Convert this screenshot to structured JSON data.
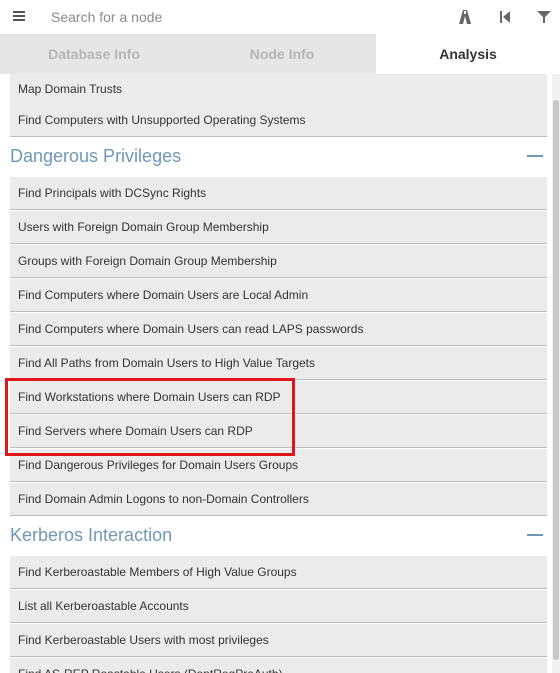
{
  "search": {
    "placeholder": "Search for a node"
  },
  "tabs": [
    {
      "label": "Database Info"
    },
    {
      "label": "Node Info"
    },
    {
      "label": "Analysis"
    }
  ],
  "queries_top": [
    "Map Domain Trusts",
    "Find Computers with Unsupported Operating Systems"
  ],
  "sections": [
    {
      "title": "Dangerous Privileges",
      "queries": [
        "Find Principals with DCSync Rights",
        "Users with Foreign Domain Group Membership",
        "Groups with Foreign Domain Group Membership",
        "Find Computers where Domain Users are Local Admin",
        "Find Computers where Domain Users can read LAPS passwords",
        "Find All Paths from Domain Users to High Value Targets",
        "Find Workstations where Domain Users can RDP",
        "Find Servers where Domain Users can RDP",
        "Find Dangerous Privileges for Domain Users Groups",
        "Find Domain Admin Logons to non-Domain Controllers"
      ]
    },
    {
      "title": "Kerberos Interaction",
      "queries": [
        "Find Kerberoastable Members of High Value Groups",
        "List all Kerberoastable Accounts",
        "Find Kerberoastable Users with most privileges",
        "Find AS-REP Roastable Users (DontReqPreAuth)"
      ]
    }
  ],
  "colors": {
    "section_title": "#6f98b7",
    "highlight": "#e0161c",
    "tab_bar": "#e6e6e6",
    "query_bg": "#ebebeb"
  },
  "icons": [
    "menu-icon",
    "path-icon",
    "back-icon",
    "filter-icon",
    "collapse-icon"
  ]
}
